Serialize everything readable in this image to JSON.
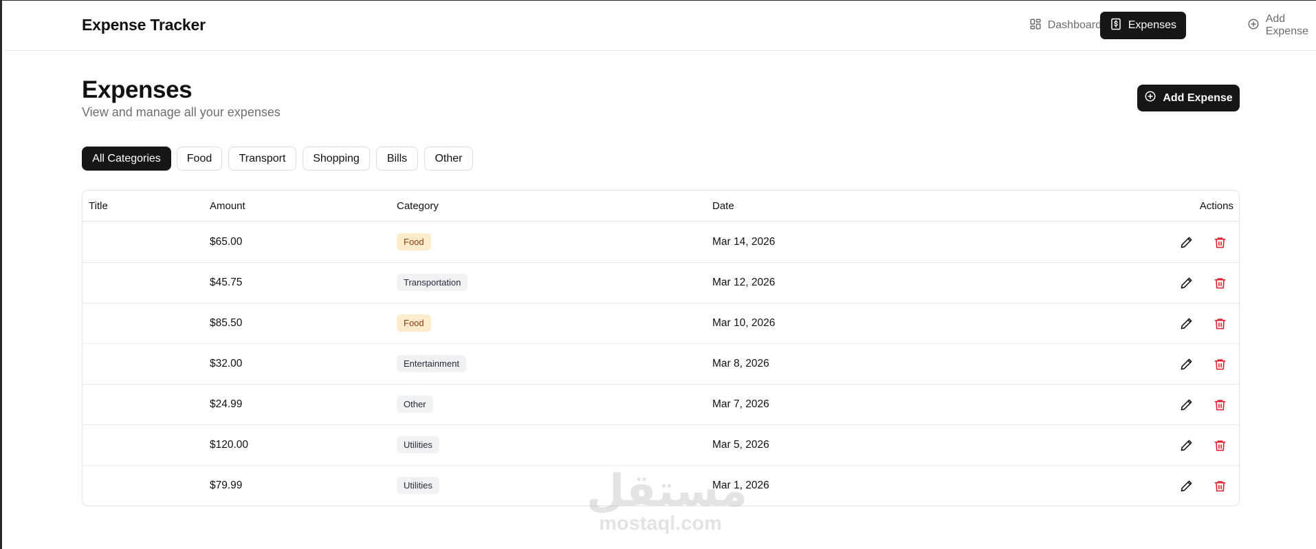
{
  "app": {
    "brand": "Expense Tracker"
  },
  "nav": {
    "items": [
      {
        "label": "Dashboard",
        "icon": "dashboard-icon",
        "active": false
      },
      {
        "label": "Expenses",
        "icon": "receipt-icon",
        "active": true
      },
      {
        "label": "Add Expense",
        "icon": "plus-circle-icon",
        "active": false
      }
    ]
  },
  "page": {
    "title": "Expenses",
    "subtitle": "View and manage all your expenses",
    "add_button": "Add Expense"
  },
  "filters": [
    {
      "label": "All Categories",
      "active": true
    },
    {
      "label": "Food",
      "active": false
    },
    {
      "label": "Transport",
      "active": false
    },
    {
      "label": "Shopping",
      "active": false
    },
    {
      "label": "Bills",
      "active": false
    },
    {
      "label": "Other",
      "active": false
    }
  ],
  "table": {
    "columns": [
      "Title",
      "Amount",
      "Category",
      "Date",
      "Actions"
    ],
    "rows": [
      {
        "title": "",
        "amount": "$65.00",
        "category": "Food",
        "date": "Mar 14, 2026"
      },
      {
        "title": "",
        "amount": "$45.75",
        "category": "Transportation",
        "date": "Mar 12, 2026"
      },
      {
        "title": "",
        "amount": "$85.50",
        "category": "Food",
        "date": "Mar 10, 2026"
      },
      {
        "title": "",
        "amount": "$32.00",
        "category": "Entertainment",
        "date": "Mar 8, 2026"
      },
      {
        "title": "",
        "amount": "$24.99",
        "category": "Other",
        "date": "Mar 7, 2026"
      },
      {
        "title": "",
        "amount": "$120.00",
        "category": "Utilities",
        "date": "Mar 5, 2026"
      },
      {
        "title": "",
        "amount": "$79.99",
        "category": "Utilities",
        "date": "Mar 1, 2026"
      }
    ]
  },
  "watermark": {
    "arabic": "مستقل",
    "latin": "mostaql.com"
  },
  "colors": {
    "primary": "#161616",
    "food_badge_bg": "#fdeccb",
    "food_badge_text": "#8a3b12",
    "neutral_badge_bg": "#f1f2f4",
    "delete": "#e11d2e"
  }
}
